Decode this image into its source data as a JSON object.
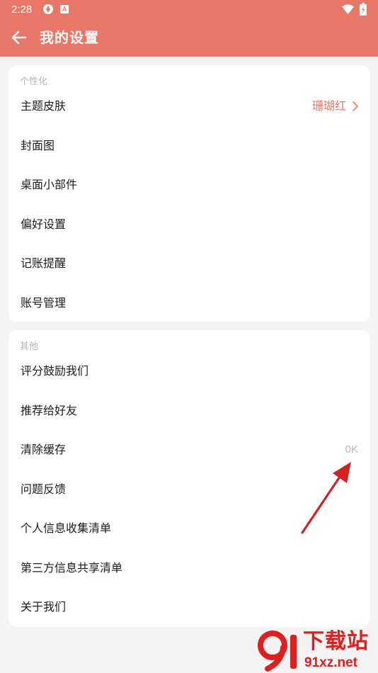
{
  "status_bar": {
    "time": "2:28",
    "icons": [
      "sync-icon",
      "a-icon",
      "wifi-icon",
      "battery-icon"
    ],
    "a_icon_text": "A"
  },
  "app_bar": {
    "title": "我的设置",
    "back_icon": "arrow-left-icon"
  },
  "sections": [
    {
      "header": "个性化",
      "items": [
        {
          "label": "主题皮肤",
          "value": "珊瑚红",
          "chevron": true
        },
        {
          "label": "封面图"
        },
        {
          "label": "桌面小部件"
        },
        {
          "label": "偏好设置"
        },
        {
          "label": "记账提醒"
        },
        {
          "label": "账号管理"
        }
      ]
    },
    {
      "header": "其他",
      "items": [
        {
          "label": "评分鼓励我们"
        },
        {
          "label": "推荐给好友"
        },
        {
          "label": "清除缓存",
          "value": "0K"
        },
        {
          "label": "问题反馈"
        },
        {
          "label": "个人信息收集清单"
        },
        {
          "label": "第三方信息共享清单"
        },
        {
          "label": "关于我们"
        }
      ]
    }
  ],
  "watermark": {
    "logo_text": "91",
    "text": "下载站",
    "url": "91xz.net"
  },
  "colors": {
    "accent": "#e97767",
    "background": "#f4f4f4",
    "card": "#ffffff",
    "annotation_arrow": "#d42020",
    "watermark": "#e01e1e"
  }
}
